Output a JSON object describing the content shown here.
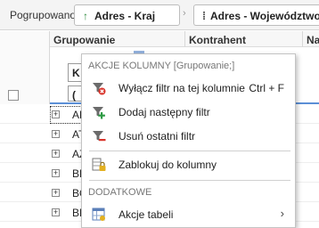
{
  "grouping_bar": {
    "label": "Pogrupowano:",
    "chips": [
      {
        "label": "Adres - Kraj",
        "icon": "sort-ascending-icon"
      },
      {
        "label": "Adres - Województwo",
        "icon": "drag-handle-icon"
      }
    ]
  },
  "grid": {
    "headers": {
      "group": "Grupowanie",
      "contractor": "Kontrahent",
      "name": "Nazwa"
    },
    "filter_fields": [
      "K",
      "("
    ],
    "rows": [
      {
        "code": "AF",
        "expand": "+"
      },
      {
        "code": "AT",
        "expand": "+"
      },
      {
        "code": "AZ",
        "expand": "+"
      },
      {
        "code": "BE",
        "expand": "+"
      },
      {
        "code": "BG",
        "expand": "+"
      },
      {
        "code": "BM",
        "expand": "+"
      }
    ]
  },
  "context_menu": {
    "section1_title": "AKCJE KOLUMNY [Grupowanie;]",
    "items": [
      {
        "label": "Wyłącz filtr na tej kolumnie",
        "shortcut": "Ctrl + F",
        "icon": "filter-off-icon"
      },
      {
        "label": "Dodaj następny filtr",
        "icon": "filter-add-icon"
      },
      {
        "label": "Usuń ostatni filtr",
        "icon": "filter-remove-icon"
      },
      {
        "label": "Zablokuj do kolumny",
        "icon": "lock-column-icon"
      }
    ],
    "section2_title": "DODATKOWE",
    "extra_items": [
      {
        "label": "Akcje tabeli",
        "icon": "table-actions-icon",
        "submenu_arrow": "›"
      }
    ]
  },
  "colors": {
    "accent_blue": "#5b8fd6",
    "filter_red": "#d9342b",
    "filter_green": "#2e9b45",
    "lock_yellow": "#e3b020"
  }
}
